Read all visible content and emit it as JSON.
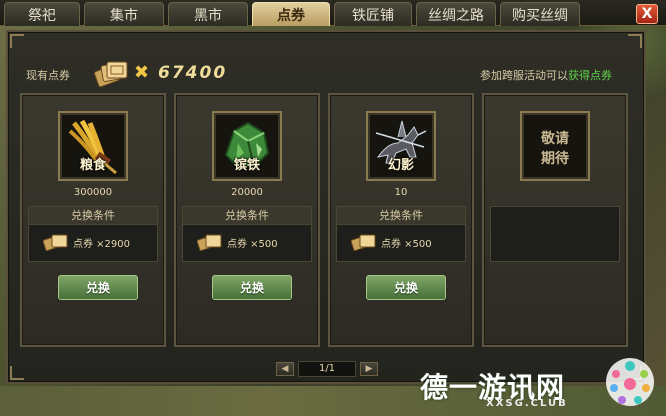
{
  "tabs": [
    {
      "label": "祭祀",
      "active": false
    },
    {
      "label": "集市",
      "active": false
    },
    {
      "label": "黑市",
      "active": false
    },
    {
      "label": "点券",
      "active": true
    },
    {
      "label": "铁匠铺",
      "active": false
    },
    {
      "label": "丝绸之路",
      "active": false
    },
    {
      "label": "购买丝绸",
      "active": false
    }
  ],
  "close_label": "X",
  "header": {
    "current_label": "现有点券",
    "times_symbol": "✖",
    "balance": "67400",
    "cross_server_text": "参加跨服活动可以",
    "cross_server_link": "获得点券"
  },
  "cards": [
    {
      "name": "粮食",
      "quantity": "300000",
      "condition_title": "兑换条件",
      "cost": "点券 ×2900",
      "button": "兑换",
      "icon": "grain-icon"
    },
    {
      "name": "镔铁",
      "quantity": "20000",
      "condition_title": "兑换条件",
      "cost": "点券 ×500",
      "button": "兑换",
      "icon": "iron-ore-icon"
    },
    {
      "name": "幻影",
      "quantity": "10",
      "condition_title": "兑换条件",
      "cost": "点券 ×500",
      "button": "兑换",
      "icon": "phantom-horse-icon"
    },
    {
      "name": "敬请期待",
      "placeholder_line1": "敬请",
      "placeholder_line2": "期待"
    }
  ],
  "pager": {
    "text": "1/1",
    "prev": "◀",
    "next": "▶"
  },
  "watermark": {
    "title": "德一游讯网",
    "url": "XXSG.CLUB"
  },
  "colors": {
    "accent_gold": "#f0dc9a",
    "link_green": "#5fd04a",
    "button_green": "#5f8a4d",
    "active_tab": "#d9c08a"
  }
}
